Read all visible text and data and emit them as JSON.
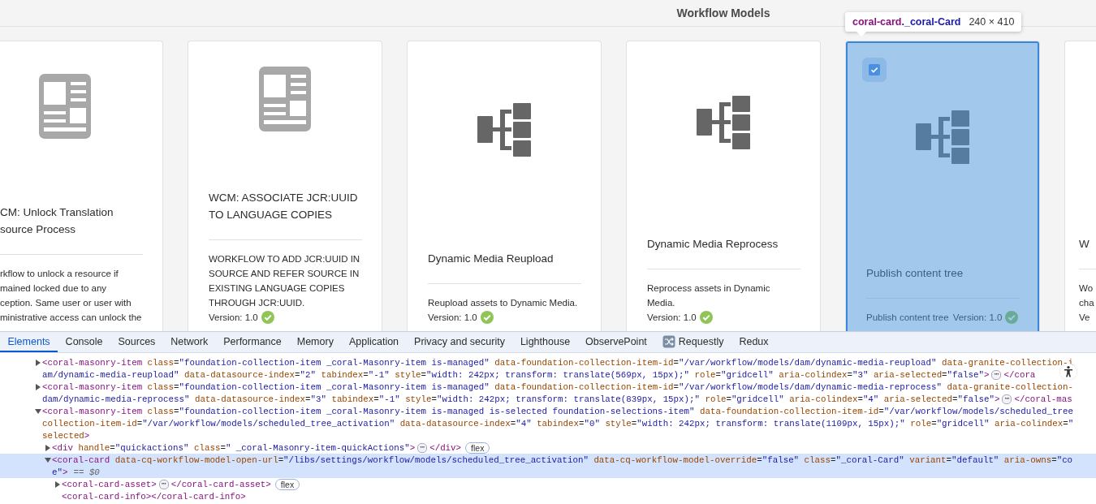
{
  "header": {
    "title": "Workflow Models"
  },
  "cards": [
    {
      "kind": "document",
      "title": "CM: Unlock Translation\nsource Process",
      "description": "rkflow to unlock a resource if\nmained locked due to any\nception. Same user or user with\nministrative access can unlock the",
      "selected": false
    },
    {
      "kind": "document",
      "title": "WCM: ASSOCIATE JCR:UUID TO LANGUAGE COPIES",
      "description": "WORKFLOW TO ADD JCR:UUID IN SOURCE AND REFER SOURCE IN EXISTING LANGUAGE COPIES THROUGH JCR:UUID.",
      "version": "Version: 1.0",
      "selected": false
    },
    {
      "kind": "workflow",
      "title": "Dynamic Media Reupload",
      "description": "Reupload assets to Dynamic Media.",
      "version": "Version: 1.0",
      "selected": false
    },
    {
      "kind": "workflow",
      "title": "Dynamic Media Reprocess",
      "description": "Reprocess assets in Dynamic Media.",
      "version": "Version: 1.0",
      "selected": false
    },
    {
      "kind": "workflow",
      "title": "Publish content tree",
      "description": "Publish content tree",
      "version": "Version: 1.0",
      "selected": true
    },
    {
      "kind": "text",
      "title": "W",
      "description": "Wo\ncha\nVe",
      "selected": false
    }
  ],
  "inspector_tooltip": {
    "element": "coral-card",
    "class": "._coral-Card",
    "size": "240 × 410"
  },
  "devtools": {
    "tabs": [
      {
        "label": "Elements",
        "selected": true
      },
      {
        "label": "Console",
        "selected": false
      },
      {
        "label": "Sources",
        "selected": false
      },
      {
        "label": "Network",
        "selected": false
      },
      {
        "label": "Performance",
        "selected": false
      },
      {
        "label": "Memory",
        "selected": false
      },
      {
        "label": "Application",
        "selected": false
      },
      {
        "label": "Privacy and security",
        "selected": false
      },
      {
        "label": "Lighthouse",
        "selected": false
      },
      {
        "label": "ObservePoint",
        "selected": false
      },
      {
        "label": "Requestly",
        "selected": false,
        "kind": "extension"
      },
      {
        "label": "Redux",
        "selected": false
      }
    ],
    "tree": [
      {
        "expanded": false,
        "selected": false,
        "lines": [
          [
            {
              "kind": "code",
              "text": "<coral-masonry-item class=\"foundation-collection-item _coral-Masonry-item is-managed\" data-foundation-collection-item-id=\"/var/workflow/models/dam/dynamic-media-reupload\" data-granite-collection-i"
            }
          ],
          [
            {
              "kind": "code",
              "text": "am/dynamic-media-reupload\" data-datasource-index=\"2\" tabindex=\"-1\" style=\"width: 242px; transform: translate(569px, 15px);\" role=\"gridcell\" aria-colindex=\"3\" aria-selected=\"false\">"
            },
            {
              "kind": "ellipsis",
              "text": "⋯"
            },
            {
              "kind": "code",
              "text": "</cora"
            }
          ]
        ]
      },
      {
        "expanded": false,
        "selected": false,
        "lines": [
          [
            {
              "kind": "code",
              "text": "<coral-masonry-item class=\"foundation-collection-item _coral-Masonry-item is-managed\" data-foundation-collection-item-id=\"/var/workflow/models/dam/dynamic-media-reprocess\" data-granite-collection-"
            }
          ],
          [
            {
              "kind": "code",
              "text": "dam/dynamic-media-reprocess\" data-datasource-index=\"3\" tabindex=\"-1\" style=\"width: 242px; transform: translate(839px, 15px);\" role=\"gridcell\" aria-colindex=\"4\" aria-selected=\"false\">"
            },
            {
              "kind": "ellipsis",
              "text": "⋯"
            },
            {
              "kind": "code",
              "text": "</coral-mas"
            }
          ]
        ]
      },
      {
        "expanded": true,
        "selected": false,
        "lines": [
          [
            {
              "kind": "code",
              "text": "<coral-masonry-item class=\"foundation-collection-item _coral-Masonry-item is-managed is-selected foundation-selections-item\" data-foundation-collection-item-id=\"/var/workflow/models/scheduled_tree"
            }
          ],
          [
            {
              "kind": "code",
              "text": "collection-item-id=\"/var/workflow/models/scheduled_tree_activation\" data-datasource-index=\"4\" tabindex=\"0\" style=\"width: 242px; transform: translate(1109px, 15px);\" role=\"gridcell\" aria-colindex=\""
            }
          ],
          [
            {
              "kind": "code",
              "text": "selected>"
            }
          ]
        ],
        "children": [
          {
            "expanded": false,
            "selected": false,
            "lines": [
              [
                {
                  "kind": "code",
                  "text": "<div handle=\"quickactions\" class=\" _coral-Masonry-item-quickActions\">"
                },
                {
                  "kind": "ellipsis",
                  "text": "⋯"
                },
                {
                  "kind": "code",
                  "text": "</div>"
                },
                {
                  "kind": "badge",
                  "text": "flex"
                }
              ]
            ]
          },
          {
            "expanded": true,
            "selected": true,
            "lines": [
              [
                {
                  "kind": "code",
                  "text": "<coral-card data-cq-workflow-model-open-url=\"/libs/settings/workflow/models/scheduled_tree_activation\" data-cq-workflow-model-override=\"false\" class=\"_coral-Card\" variant=\"default\" aria-owns=\"co"
                }
              ],
              [
                {
                  "kind": "code",
                  "text": "e\">"
                },
                {
                  "kind": "note",
                  "text": "== $0"
                }
              ]
            ],
            "children": [
              {
                "expanded": false,
                "selected": false,
                "lines": [
                  [
                    {
                      "kind": "code",
                      "text": "<coral-card-asset>"
                    },
                    {
                      "kind": "ellipsis",
                      "text": "⋯"
                    },
                    {
                      "kind": "code",
                      "text": "</coral-card-asset>"
                    },
                    {
                      "kind": "badge",
                      "text": "flex"
                    }
                  ]
                ]
              },
              {
                "selected": false,
                "lines": [
                  [
                    {
                      "kind": "code",
                      "text": "<coral-card-info></coral-card-info>"
                    }
                  ]
                ]
              }
            ]
          }
        ]
      }
    ]
  }
}
